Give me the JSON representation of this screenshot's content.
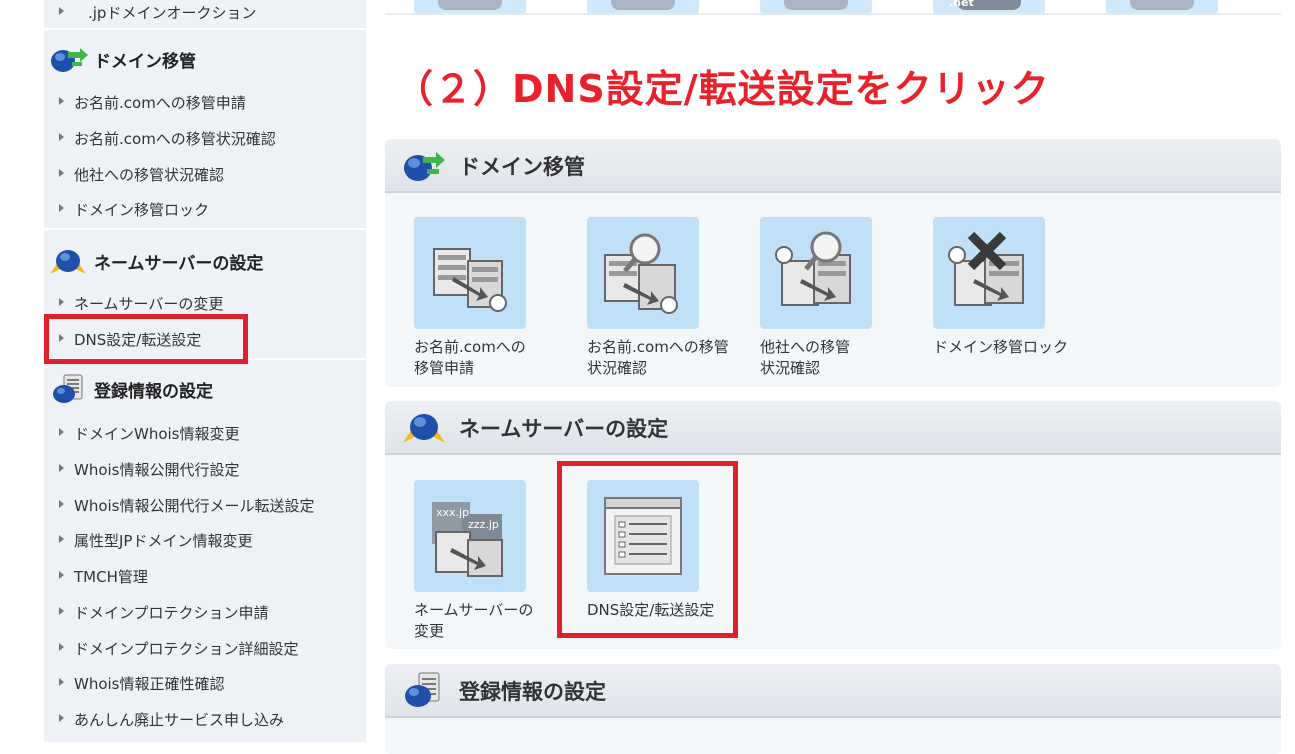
{
  "instruction": "（２）DNS設定/転送設定をクリック",
  "sidebar": {
    "top_item": ".jpドメインオークション",
    "sections": [
      {
        "title": "ドメイン移管",
        "icon": "globe-arrows-icon",
        "items": [
          "お名前.comへの移管申請",
          "お名前.comへの移管状況確認",
          "他社への移管状況確認",
          "ドメイン移管ロック"
        ]
      },
      {
        "title": "ネームサーバーの設定",
        "icon": "globe-arrows-icon",
        "items": [
          "ネームサーバーの変更",
          "DNS設定/転送設定"
        ]
      },
      {
        "title": "登録情報の設定",
        "icon": "registration-globe-icon",
        "items": [
          "ドメインWhois情報変更",
          "Whois情報公開代行設定",
          "Whois情報公開代行メール転送設定",
          "属性型JPドメイン情報変更",
          "TMCH管理",
          "ドメインプロテクション申請",
          "ドメインプロテクション詳細設定",
          "Whois情報正確性確認",
          "あんしん廃止サービス申し込み"
        ]
      }
    ]
  },
  "main": {
    "sections": [
      {
        "title": "ドメイン移管",
        "tiles": [
          {
            "line1": "お名前.comへの",
            "line2": "移管申請",
            "icon": "transfer-servers-icon"
          },
          {
            "line1": "お名前.comへの移管",
            "line2": "状況確認",
            "icon": "transfer-status-icon"
          },
          {
            "line1": "他社への移管",
            "line2": "状況確認",
            "icon": "transfer-status-icon"
          },
          {
            "line1": "ドメイン移管ロック",
            "line2": "",
            "icon": "transfer-lock-icon"
          }
        ]
      },
      {
        "title": "ネームサーバーの設定",
        "tiles": [
          {
            "line1": "ネームサーバーの",
            "line2": "変更",
            "icon": "nameserver-change-icon",
            "labels": [
              "xxx.jp",
              "zzz.jp"
            ]
          },
          {
            "line1": "DNS設定/転送設定",
            "line2": "",
            "icon": "dns-settings-icon"
          }
        ]
      },
      {
        "title": "登録情報の設定",
        "tiles": []
      }
    ],
    "top_tile_labels": [
      ".net"
    ]
  },
  "colors": {
    "highlight": "#e0202b",
    "instruction": "#e8212b",
    "tile_bg": "#bfe0f7",
    "sidebar_bg": "#eef2f7"
  }
}
